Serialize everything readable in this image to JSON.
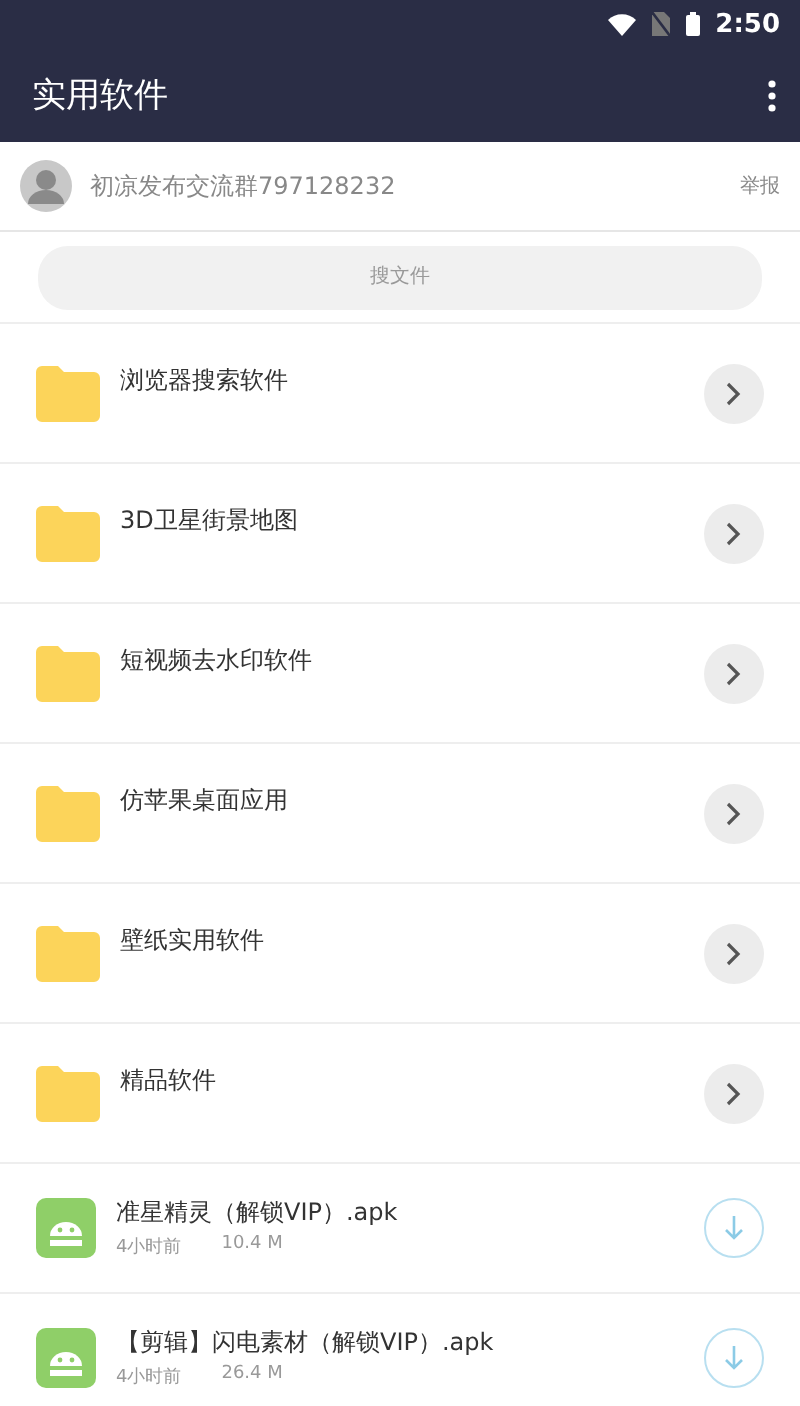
{
  "status_bar": {
    "time": "2:50"
  },
  "toolbar": {
    "title": "实用软件"
  },
  "notice": {
    "text": "初凉发布交流群797128232",
    "action": "举报"
  },
  "search": {
    "placeholder": "搜文件"
  },
  "items": [
    {
      "kind": "folder",
      "name": "浏览器搜索软件"
    },
    {
      "kind": "folder",
      "name": "3D卫星街景地图"
    },
    {
      "kind": "folder",
      "name": "短视频去水印软件"
    },
    {
      "kind": "folder",
      "name": "仿苹果桌面应用"
    },
    {
      "kind": "folder",
      "name": "壁纸实用软件"
    },
    {
      "kind": "folder",
      "name": "精品软件"
    },
    {
      "kind": "file",
      "name": "准星精灵（解锁VIP）.apk",
      "time": "4小时前",
      "size": "10.4 M"
    },
    {
      "kind": "file",
      "name": "【剪辑】闪电素材（解锁VIP）.apk",
      "time": "4小时前",
      "size": "26.4 M"
    }
  ]
}
